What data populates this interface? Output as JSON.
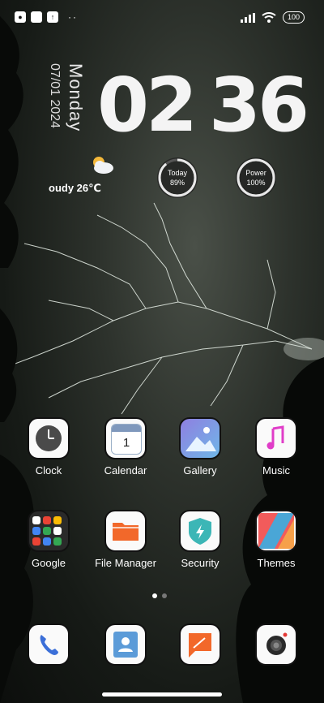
{
  "status_bar": {
    "notification_icons": [
      "app-icon",
      "app-icon",
      "upload-icon"
    ],
    "overflow": "··",
    "battery": "100"
  },
  "lock_widget": {
    "day": "Monday",
    "date": "07/01 2024",
    "time_hour": "02",
    "time_minute": "36"
  },
  "weather": {
    "text": "oudy 26℃",
    "icon": "partly-cloudy-icon"
  },
  "rings": {
    "today": {
      "label": "Today",
      "value": "89%",
      "progress": 0.89
    },
    "power": {
      "label": "Power",
      "value": "100%",
      "progress": 1.0
    }
  },
  "apps_row1": [
    {
      "label": "Clock",
      "icon": "clock-icon"
    },
    {
      "label": "Calendar",
      "icon": "calendar-icon",
      "badge": "1"
    },
    {
      "label": "Gallery",
      "icon": "gallery-icon"
    },
    {
      "label": "Music",
      "icon": "music-icon"
    }
  ],
  "apps_row2": [
    {
      "label": "Google",
      "icon": "google-folder-icon"
    },
    {
      "label": "File Manager",
      "icon": "folder-icon"
    },
    {
      "label": "Security",
      "icon": "shield-icon"
    },
    {
      "label": "Themes",
      "icon": "themes-icon"
    }
  ],
  "dock": [
    {
      "icon": "phone-icon"
    },
    {
      "icon": "contacts-icon"
    },
    {
      "icon": "messages-icon"
    },
    {
      "icon": "camera-icon"
    }
  ],
  "pager": {
    "pages": 2,
    "current": 1
  },
  "colors": {
    "accent_orange": "#F2682A",
    "accent_music": "#E03DC8",
    "security_teal": "#3CB6B6"
  }
}
